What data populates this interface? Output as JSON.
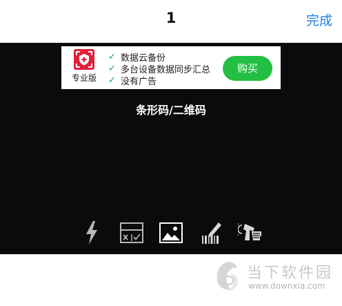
{
  "navbar": {
    "title": "1",
    "done_label": "完成"
  },
  "ad": {
    "logo_label": "专业版",
    "features": [
      "数据云备份",
      "多台设备数据同步汇总",
      "没有广告"
    ],
    "check_glyph": "✓",
    "buy_label": "购买"
  },
  "scanner": {
    "mode_label": "条形码/二维码"
  },
  "toolbar": {
    "icons": [
      "flash-icon",
      "compare-sheet-icon",
      "image-gallery-icon",
      "barcode-edit-icon",
      "hand-scanner-icon"
    ]
  },
  "watermark": {
    "title": "当下软件园",
    "url": "www.downxia.com"
  },
  "colors": {
    "accent_blue": "#1a7fe0",
    "buy_green": "#22bf43",
    "check_green": "#1ea33a",
    "logo_red": "#e2203a",
    "scanner_bg": "#0b0b0d"
  }
}
